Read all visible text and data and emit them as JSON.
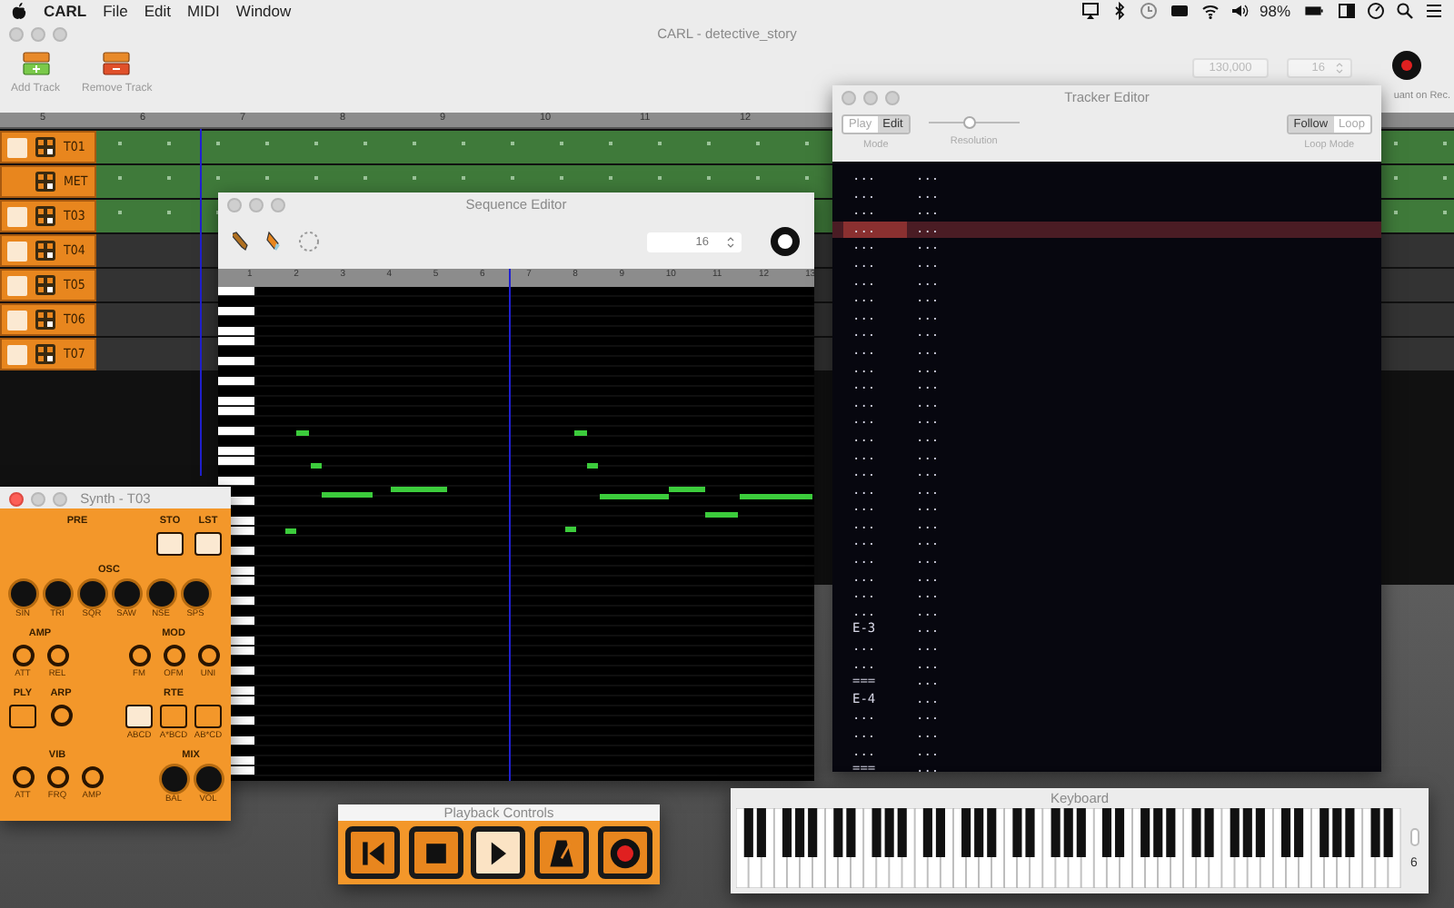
{
  "menubar": {
    "app": "CARL",
    "menus": [
      "File",
      "Edit",
      "MIDI",
      "Window"
    ],
    "battery": "98%"
  },
  "main_window": {
    "title": "CARL - detective_story",
    "focused": false,
    "toolbar": [
      {
        "label": "Add Track",
        "kind": "add"
      },
      {
        "label": "Remove Track",
        "kind": "remove"
      }
    ],
    "tempo": "130,000",
    "division": "16",
    "quantize_label": "uant on Rec.",
    "ruler": [
      "5",
      "6",
      "7",
      "8",
      "9",
      "10",
      "11",
      "12"
    ],
    "tracks": [
      {
        "name": "T01",
        "kind": "track",
        "checked": false,
        "filled": true
      },
      {
        "name": "MET",
        "kind": "metronome",
        "filled": true
      },
      {
        "name": "T03",
        "kind": "track",
        "checked": false,
        "filled": true
      },
      {
        "name": "T04",
        "kind": "track",
        "checked": false,
        "filled": false
      },
      {
        "name": "T05",
        "kind": "track",
        "checked": false,
        "filled": false
      },
      {
        "name": "T06",
        "kind": "track",
        "checked": false,
        "filled": false
      },
      {
        "name": "T07",
        "kind": "track",
        "checked": false,
        "filled": false
      }
    ]
  },
  "sequence_editor": {
    "title": "Sequence Editor",
    "focused": false,
    "grid": "16",
    "ruler": [
      "1",
      "2",
      "3",
      "4",
      "5",
      "6",
      "7",
      "8",
      "9",
      "10",
      "11",
      "12",
      "13"
    ]
  },
  "tracker_editor": {
    "title": "Tracker Editor",
    "focused": false,
    "mode": {
      "caption": "Mode",
      "options": [
        {
          "label": "Play",
          "selected": false
        },
        {
          "label": "Edit",
          "selected": true
        }
      ]
    },
    "resolution": {
      "caption": "Resolution",
      "level": 0.45
    },
    "loop_mode": {
      "caption": "Loop Mode",
      "options": [
        {
          "label": "Follow",
          "selected": true
        },
        {
          "label": "Loop",
          "selected": false
        }
      ]
    },
    "rows": [
      {
        "cells": [
          "...",
          "..."
        ],
        "selected": false
      },
      {
        "cells": [
          "...",
          "..."
        ],
        "selected": false
      },
      {
        "cells": [
          "...",
          "..."
        ],
        "selected": false
      },
      {
        "cells": [
          "...",
          "..."
        ],
        "selected": true
      },
      {
        "cells": [
          "...",
          "..."
        ],
        "selected": false
      },
      {
        "cells": [
          "...",
          "..."
        ],
        "selected": false
      },
      {
        "cells": [
          "...",
          "..."
        ],
        "selected": false
      },
      {
        "cells": [
          "...",
          "..."
        ],
        "selected": false
      },
      {
        "cells": [
          "...",
          "..."
        ],
        "selected": false
      },
      {
        "cells": [
          "...",
          "..."
        ],
        "selected": false
      },
      {
        "cells": [
          "...",
          "..."
        ],
        "selected": false
      },
      {
        "cells": [
          "...",
          "..."
        ],
        "selected": false
      },
      {
        "cells": [
          "...",
          "..."
        ],
        "selected": false
      },
      {
        "cells": [
          "...",
          "..."
        ],
        "selected": false
      },
      {
        "cells": [
          "...",
          "..."
        ],
        "selected": false
      },
      {
        "cells": [
          "...",
          "..."
        ],
        "selected": false
      },
      {
        "cells": [
          "...",
          "..."
        ],
        "selected": false
      },
      {
        "cells": [
          "...",
          "..."
        ],
        "selected": false
      },
      {
        "cells": [
          "...",
          "..."
        ],
        "selected": false
      },
      {
        "cells": [
          "...",
          "..."
        ],
        "selected": false
      },
      {
        "cells": [
          "...",
          "..."
        ],
        "selected": false
      },
      {
        "cells": [
          "...",
          "..."
        ],
        "selected": false
      },
      {
        "cells": [
          "...",
          "..."
        ],
        "selected": false
      },
      {
        "cells": [
          "...",
          "..."
        ],
        "selected": false
      },
      {
        "cells": [
          "...",
          "..."
        ],
        "selected": false
      },
      {
        "cells": [
          "...",
          "..."
        ],
        "selected": false
      },
      {
        "cells": [
          "E-3",
          "..."
        ],
        "selected": false
      },
      {
        "cells": [
          "...",
          "..."
        ],
        "selected": false
      },
      {
        "cells": [
          "...",
          "..."
        ],
        "selected": false
      },
      {
        "cells": [
          "===",
          "..."
        ],
        "selected": false
      },
      {
        "cells": [
          "E-4",
          "..."
        ],
        "selected": false
      },
      {
        "cells": [
          "...",
          "..."
        ],
        "selected": false
      },
      {
        "cells": [
          "...",
          "..."
        ],
        "selected": false
      },
      {
        "cells": [
          "...",
          "..."
        ],
        "selected": false
      },
      {
        "cells": [
          "===",
          "..."
        ],
        "selected": false
      }
    ]
  },
  "synth": {
    "title": "Synth - T03",
    "focused": true,
    "rows": [
      {
        "groups": [
          {
            "title": "PRE"
          },
          {
            "title": "STO",
            "controls": [
              {
                "kind": "button",
                "selected": true
              }
            ]
          },
          {
            "title": "LST",
            "controls": [
              {
                "kind": "button",
                "selected": true
              }
            ]
          }
        ]
      },
      {
        "groups": [
          {
            "title": "OSC",
            "controls": [
              {
                "label": "SIN",
                "kind": "dial"
              },
              {
                "label": "TRI",
                "kind": "dial"
              },
              {
                "label": "SQR",
                "kind": "dial"
              },
              {
                "label": "SAW",
                "kind": "dial"
              },
              {
                "label": "NSE",
                "kind": "dial"
              },
              {
                "label": "SPS",
                "kind": "dial"
              }
            ]
          }
        ]
      },
      {
        "groups": [
          {
            "title": "AMP",
            "controls": [
              {
                "label": "ATT",
                "kind": "knob"
              },
              {
                "label": "REL",
                "kind": "knob"
              }
            ]
          },
          {
            "title": "MOD",
            "controls": [
              {
                "label": "FM",
                "kind": "knob"
              },
              {
                "label": "OFM",
                "kind": "knob"
              },
              {
                "label": "UNI",
                "kind": "knob"
              }
            ]
          }
        ]
      },
      {
        "groups": [
          {
            "title": "PLY",
            "controls": [
              {
                "kind": "button",
                "selected": false
              }
            ]
          },
          {
            "title": "ARP",
            "controls": [
              {
                "kind": "knob"
              }
            ]
          },
          {
            "title": "RTE",
            "controls": [
              {
                "label": "ABCD",
                "kind": "button",
                "selected": true
              },
              {
                "label": "A*BCD",
                "kind": "button",
                "selected": false
              },
              {
                "label": "AB*CD",
                "kind": "button",
                "selected": false
              }
            ]
          }
        ]
      },
      {
        "groups": [
          {
            "title": "VIB",
            "controls": [
              {
                "label": "ATT",
                "kind": "knob"
              },
              {
                "label": "FRQ",
                "kind": "knob"
              },
              {
                "label": "AMP",
                "kind": "knob"
              }
            ]
          },
          {
            "title": "MIX",
            "controls": [
              {
                "label": "BAL",
                "kind": "dial"
              },
              {
                "label": "VOL",
                "kind": "dial"
              }
            ]
          }
        ]
      }
    ]
  },
  "playback": {
    "title": "Playback Controls",
    "buttons": [
      {
        "kind": "rewind",
        "selected": false
      },
      {
        "kind": "stop",
        "selected": false
      },
      {
        "kind": "play",
        "selected": true
      },
      {
        "kind": "metronome",
        "selected": false
      },
      {
        "kind": "record",
        "selected": false
      }
    ]
  },
  "keyboard": {
    "title": "Keyboard",
    "octave": "6"
  }
}
